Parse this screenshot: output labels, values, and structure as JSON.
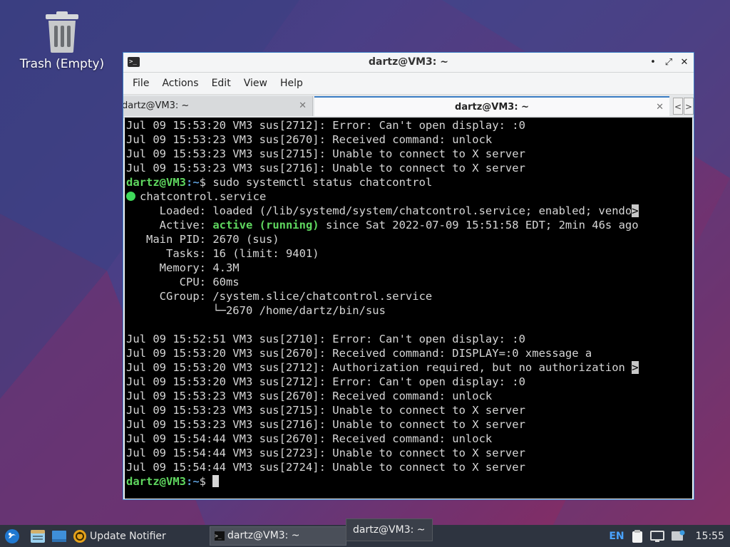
{
  "desktop": {
    "trash_label": "Trash (Empty)"
  },
  "window": {
    "title": "dartz@VM3: ~",
    "controls": {
      "minimize": "•",
      "maximize": "⤢",
      "close": "✕"
    },
    "menu": [
      "File",
      "Actions",
      "Edit",
      "View",
      "Help"
    ],
    "tabs": [
      {
        "label": "dartz@VM3: ~",
        "active": false
      },
      {
        "label": "dartz@VM3: ~",
        "active": true
      }
    ],
    "tab_scroll": {
      "left": "<",
      "right": ">"
    }
  },
  "terminal": {
    "lines": [
      {
        "type": "plain",
        "text": "Jul 09 15:53:20 VM3 sus[2712]: Error: Can't open display: :0"
      },
      {
        "type": "plain",
        "text": "Jul 09 15:53:23 VM3 sus[2670]: Received command: unlock"
      },
      {
        "type": "plain",
        "text": "Jul 09 15:53:23 VM3 sus[2715]: Unable to connect to X server"
      },
      {
        "type": "plain",
        "text": "Jul 09 15:53:23 VM3 sus[2716]: Unable to connect to X server"
      },
      {
        "type": "prompt",
        "user": "dartz@VM3",
        "path": ":~",
        "cmd": "$ sudo systemctl status chatcontrol"
      },
      {
        "type": "service",
        "text": "chatcontrol.service"
      },
      {
        "type": "trunc",
        "text": "     Loaded: loaded (/lib/systemd/system/chatcontrol.service; enabled; vendo",
        "mark": ">"
      },
      {
        "type": "active",
        "pre": "     Active: ",
        "status": "active (running)",
        "post": " since Sat 2022-07-09 15:51:58 EDT; 2min 46s ago"
      },
      {
        "type": "plain",
        "text": "   Main PID: 2670 (sus)"
      },
      {
        "type": "plain",
        "text": "      Tasks: 16 (limit: 9401)"
      },
      {
        "type": "plain",
        "text": "     Memory: 4.3M"
      },
      {
        "type": "plain",
        "text": "        CPU: 60ms"
      },
      {
        "type": "plain",
        "text": "     CGroup: /system.slice/chatcontrol.service"
      },
      {
        "type": "plain",
        "text": "             └─2670 /home/dartz/bin/sus"
      },
      {
        "type": "plain",
        "text": ""
      },
      {
        "type": "plain",
        "text": "Jul 09 15:52:51 VM3 sus[2710]: Error: Can't open display: :0"
      },
      {
        "type": "plain",
        "text": "Jul 09 15:53:20 VM3 sus[2670]: Received command: DISPLAY=:0 xmessage a"
      },
      {
        "type": "trunc",
        "text": "Jul 09 15:53:20 VM3 sus[2712]: Authorization required, but no authorization ",
        "mark": ">"
      },
      {
        "type": "plain",
        "text": "Jul 09 15:53:20 VM3 sus[2712]: Error: Can't open display: :0"
      },
      {
        "type": "plain",
        "text": "Jul 09 15:53:23 VM3 sus[2670]: Received command: unlock"
      },
      {
        "type": "plain",
        "text": "Jul 09 15:53:23 VM3 sus[2715]: Unable to connect to X server"
      },
      {
        "type": "plain",
        "text": "Jul 09 15:53:23 VM3 sus[2716]: Unable to connect to X server"
      },
      {
        "type": "plain",
        "text": "Jul 09 15:54:44 VM3 sus[2670]: Received command: unlock"
      },
      {
        "type": "plain",
        "text": "Jul 09 15:54:44 VM3 sus[2723]: Unable to connect to X server"
      },
      {
        "type": "plain",
        "text": "Jul 09 15:54:44 VM3 sus[2724]: Unable to connect to X server"
      },
      {
        "type": "prompt_cursor",
        "user": "dartz@VM3",
        "path": ":~",
        "cmd": "$ "
      }
    ]
  },
  "taskbar": {
    "update_notifier": "Update Notifier",
    "task_label": "dartz@VM3: ~",
    "tooltip": "dartz@VM3: ~",
    "language": "EN",
    "clock": "15:55"
  },
  "colors": {
    "accent": "#3b7dc4",
    "prompt_green": "#5fd75f",
    "prompt_blue": "#5c9cd6",
    "taskbar": "#2e3440"
  }
}
